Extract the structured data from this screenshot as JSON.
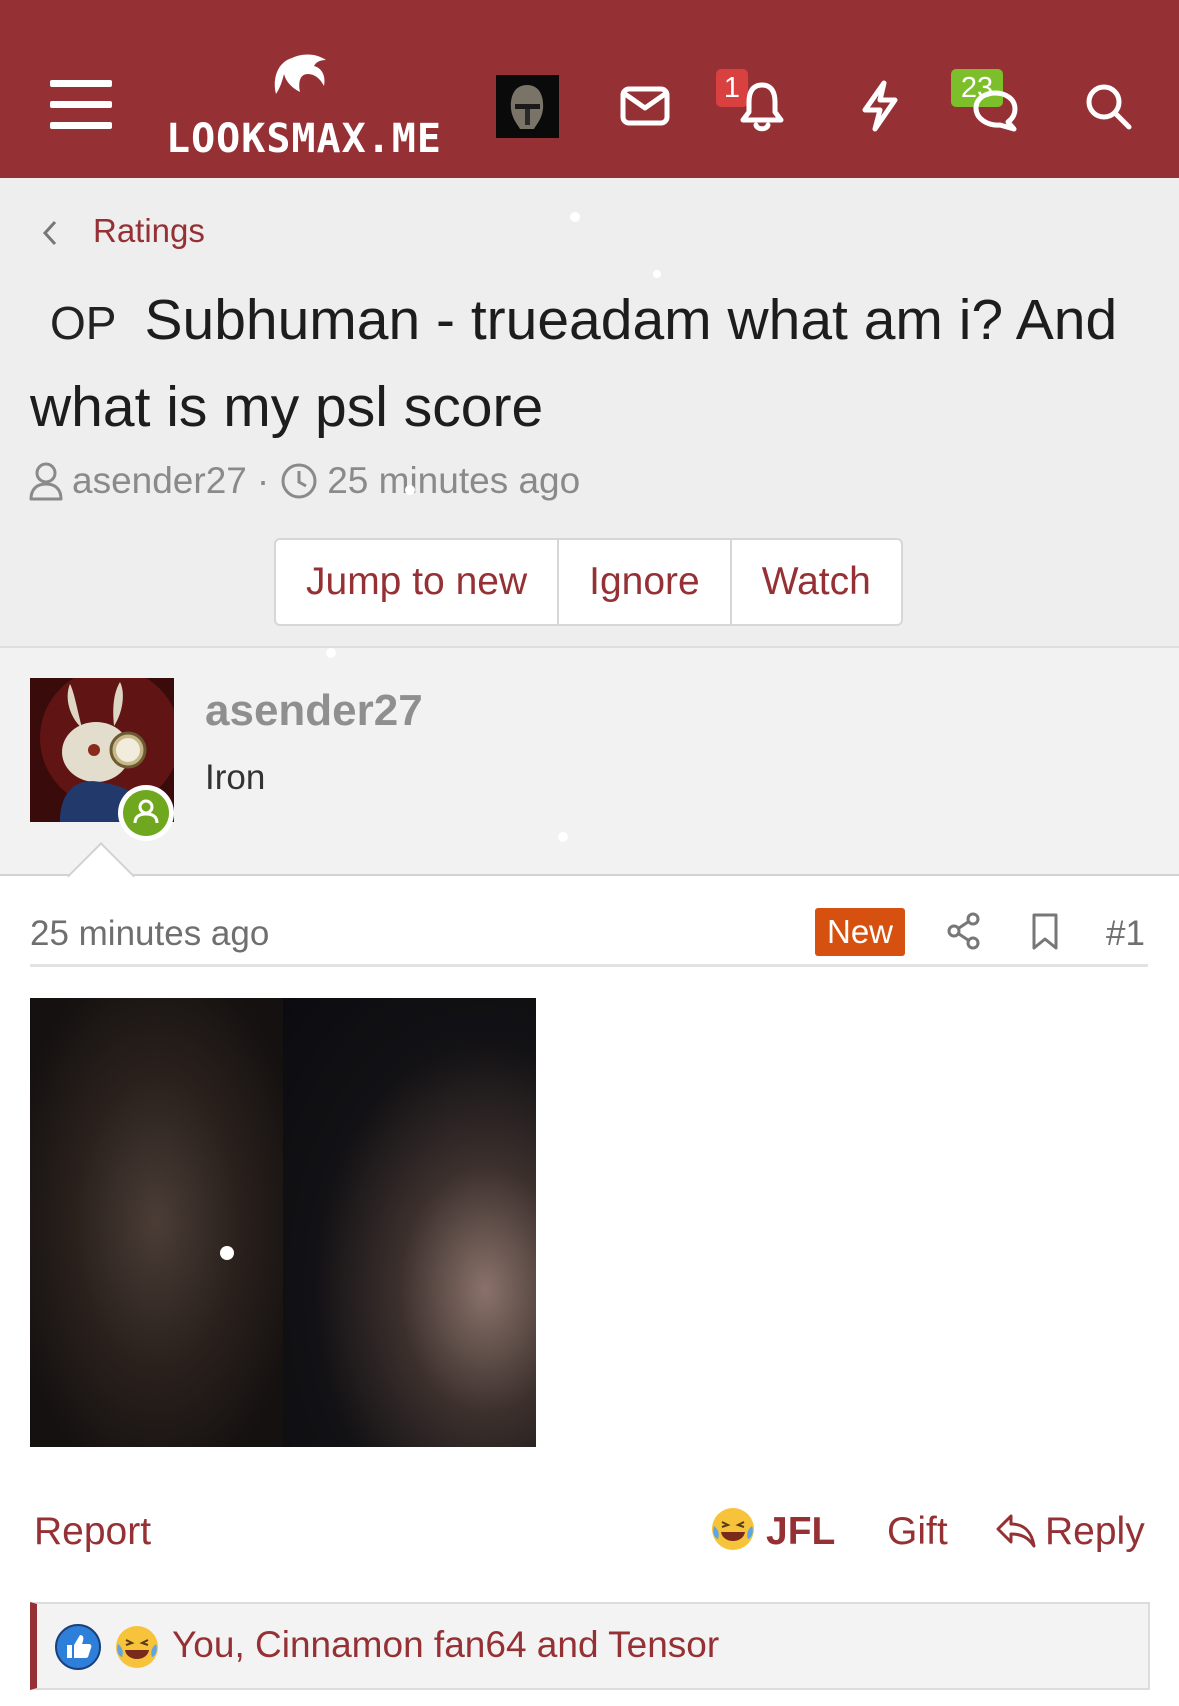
{
  "header": {
    "logo_text": "LOOKSMAX.ME",
    "notifications_count": "1",
    "conversations_count": "23",
    "icons": [
      "menu-icon",
      "mail-icon",
      "bell-icon",
      "lightning-icon",
      "chat-icon",
      "search-icon"
    ],
    "colors": {
      "brand": "#953135",
      "badge_red": "#d94040",
      "badge_green": "#7cbf2a"
    }
  },
  "breadcrumb": {
    "label": "Ratings"
  },
  "thread": {
    "prefix": "OP",
    "title": "Subhuman - trueadam what am i? And what is my psl score",
    "author": "asender27",
    "age": "25 minutes ago"
  },
  "actions": {
    "jump_label": "Jump to new",
    "ignore_label": "Ignore",
    "watch_label": "Watch"
  },
  "post": {
    "username": "asender27",
    "user_title": "Iron",
    "time": "25 minutes ago",
    "new_label": "New",
    "number": "#1",
    "colors": {
      "new_badge": "#d6510f",
      "online": "#6fa81e"
    }
  },
  "footer": {
    "report_label": "Report",
    "reaction_label": "JFL",
    "gift_label": "Gift",
    "reply_label": "Reply",
    "reactions_text": "You, Cinnamon fan64 and Tensor"
  }
}
